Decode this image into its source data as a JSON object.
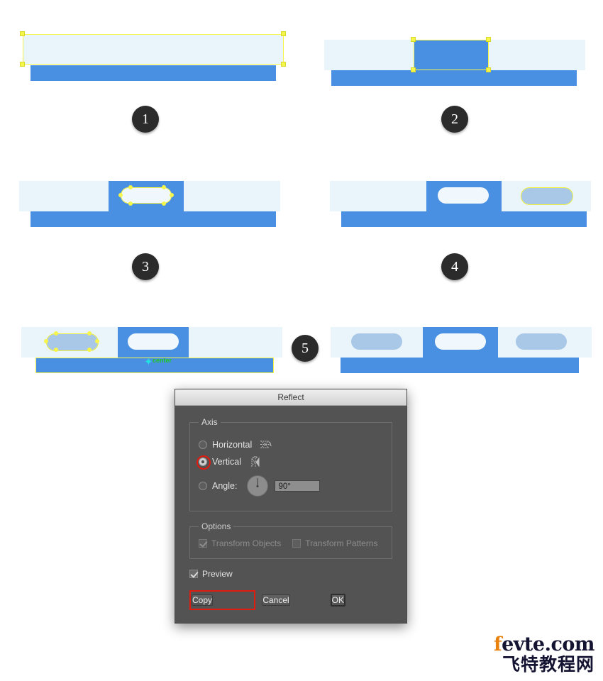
{
  "page": {
    "kind": "adobe-illustrator-tutorial-screenshot",
    "background": "#ffffff"
  },
  "palette": {
    "light_blue": "#e9f4fb",
    "medium_blue": "#4a90e2",
    "ghost_blue": "#a9c8e8",
    "white_pill": "#f0f8fd",
    "selection_yellow": "#f5f54a",
    "snap_green": "#1ec81e",
    "snap_cyan": "#25e0e0",
    "highlight_red": "#e01b10",
    "dialog_body": "#535353",
    "dialog_title": "#d2d2d2",
    "badge_dark": "#2b2b2b"
  },
  "steps": [
    {
      "number": "1",
      "caption": ""
    },
    {
      "number": "2",
      "caption": ""
    },
    {
      "number": "3",
      "caption": ""
    },
    {
      "number": "4",
      "caption": ""
    },
    {
      "number": "5",
      "caption": ""
    }
  ],
  "canvas": {
    "snap_label": "center"
  },
  "dialog": {
    "title": "Reflect",
    "axis": {
      "legend": "Axis",
      "horizontal_label": "Horizontal",
      "vertical_label": "Vertical",
      "angle_label": "Angle:",
      "angle_value": "90°",
      "selected": "Vertical"
    },
    "options": {
      "legend": "Options",
      "transform_objects_label": "Transform Objects",
      "transform_objects_checked": true,
      "transform_patterns_label": "Transform Patterns",
      "transform_patterns_checked": false,
      "preview_label": "Preview",
      "preview_checked": true
    },
    "buttons": {
      "copy": "Copy",
      "cancel": "Cancel",
      "ok": "OK"
    }
  },
  "watermark": {
    "line1_accent": "f",
    "line1_rest": "evte.com",
    "line2": "飞特教程网"
  }
}
